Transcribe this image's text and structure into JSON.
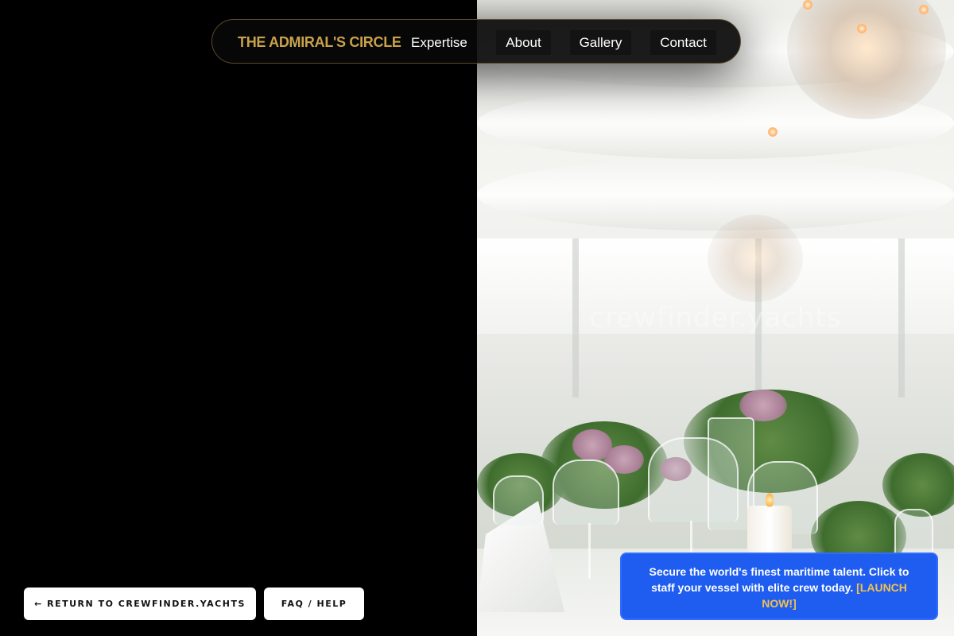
{
  "nav": {
    "brand": "THE ADMIRAL'S CIRCLE",
    "items": [
      {
        "label": "Expertise"
      },
      {
        "label": "About"
      },
      {
        "label": "Gallery"
      },
      {
        "label": "Contact"
      }
    ]
  },
  "hero": {
    "watermark": "crewfinder.yachts"
  },
  "footer_buttons": {
    "return_label": "← RETURN TO CREWFINDER.YACHTS",
    "faq_label": "FAQ / HELP"
  },
  "promo": {
    "text": "Secure the world's finest maritime talent. Click to staff your vessel with elite crew today.",
    "cta": "[LAUNCH NOW!]"
  },
  "colors": {
    "brand_gold": "#c9a24a",
    "promo_blue": "#1f5df0",
    "promo_cta": "#f2c14e",
    "background": "#000000"
  }
}
